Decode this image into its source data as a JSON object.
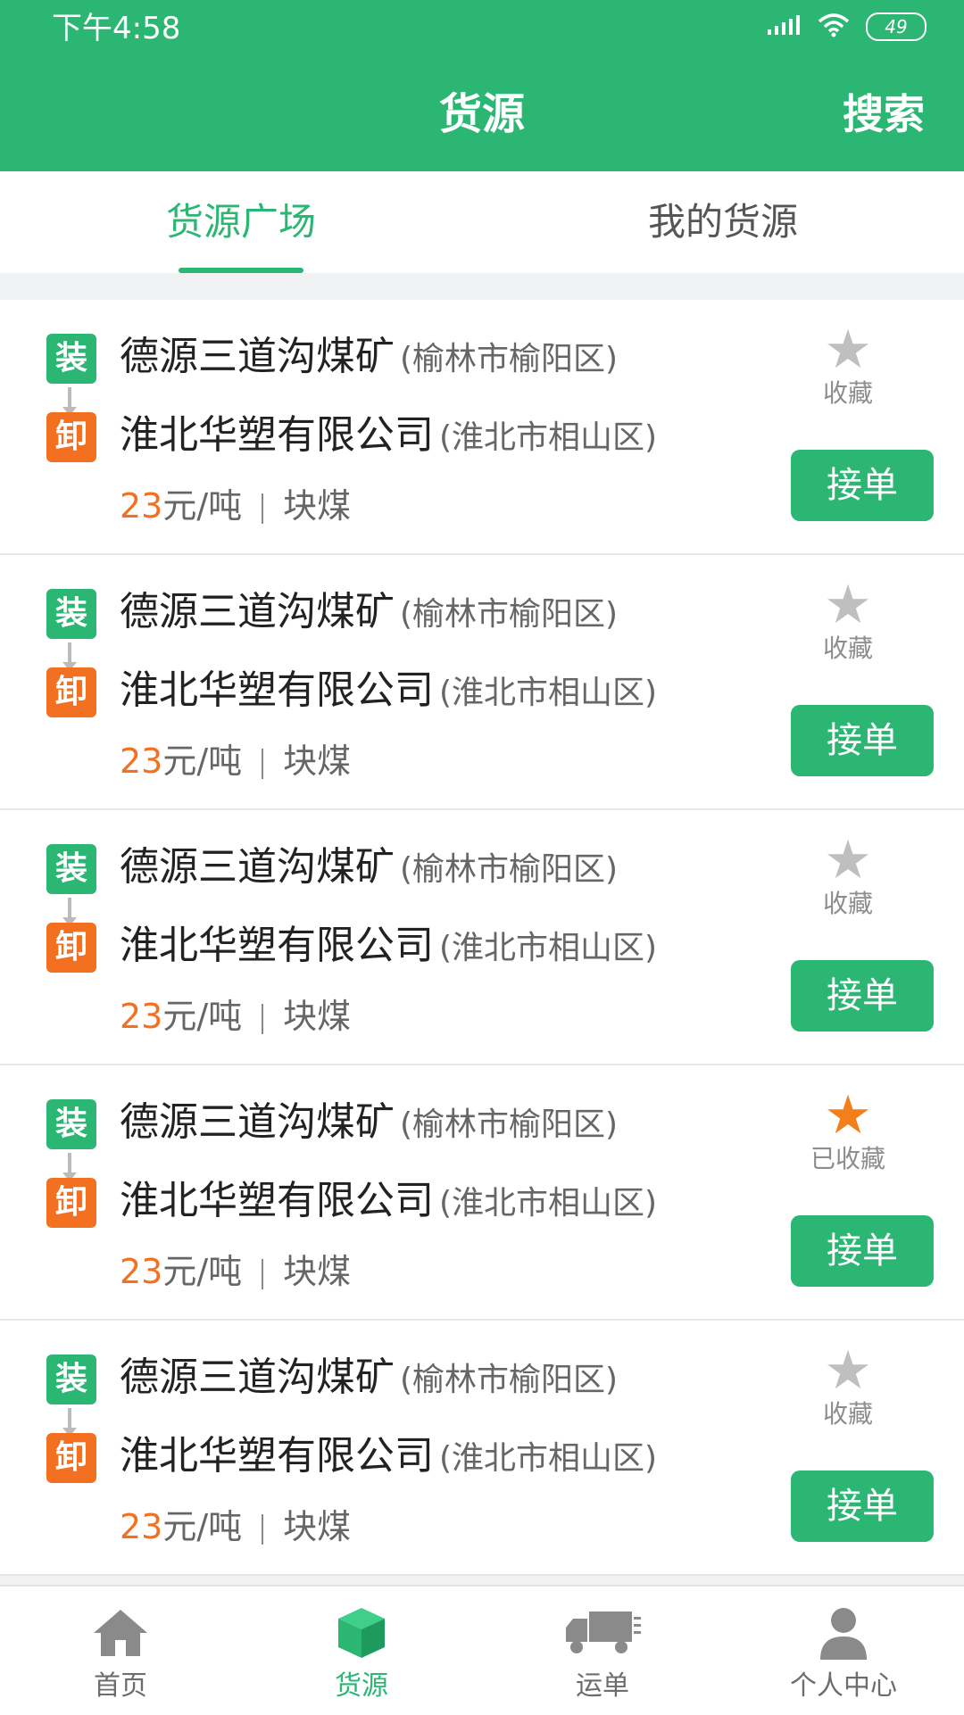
{
  "status_bar": {
    "time": "下午4:58",
    "battery": "49"
  },
  "header": {
    "title": "货源",
    "search": "搜索"
  },
  "tabs": [
    {
      "label": "货源广场",
      "active": true
    },
    {
      "label": "我的货源",
      "active": false
    }
  ],
  "cards": [
    {
      "load_badge": "装",
      "unload_badge": "卸",
      "origin": "德源三道沟煤矿",
      "origin_area": "(榆林市榆阳区)",
      "destination": "淮北华塑有限公司",
      "destination_area": "(淮北市相山区)",
      "price": "23",
      "unit": "元/吨",
      "cargo": "块煤",
      "favorite": "收藏",
      "favorited": false,
      "take_label": "接单"
    },
    {
      "load_badge": "装",
      "unload_badge": "卸",
      "origin": "德源三道沟煤矿",
      "origin_area": "(榆林市榆阳区)",
      "destination": "淮北华塑有限公司",
      "destination_area": "(淮北市相山区)",
      "price": "23",
      "unit": "元/吨",
      "cargo": "块煤",
      "favorite": "收藏",
      "favorited": false,
      "take_label": "接单"
    },
    {
      "load_badge": "装",
      "unload_badge": "卸",
      "origin": "德源三道沟煤矿",
      "origin_area": "(榆林市榆阳区)",
      "destination": "淮北华塑有限公司",
      "destination_area": "(淮北市相山区)",
      "price": "23",
      "unit": "元/吨",
      "cargo": "块煤",
      "favorite": "收藏",
      "favorited": false,
      "take_label": "接单"
    },
    {
      "load_badge": "装",
      "unload_badge": "卸",
      "origin": "德源三道沟煤矿",
      "origin_area": "(榆林市榆阳区)",
      "destination": "淮北华塑有限公司",
      "destination_area": "(淮北市相山区)",
      "price": "23",
      "unit": "元/吨",
      "cargo": "块煤",
      "favorite": "已收藏",
      "favorited": true,
      "take_label": "接单"
    },
    {
      "load_badge": "装",
      "unload_badge": "卸",
      "origin": "德源三道沟煤矿",
      "origin_area": "(榆林市榆阳区)",
      "destination": "淮北华塑有限公司",
      "destination_area": "(淮北市相山区)",
      "price": "23",
      "unit": "元/吨",
      "cargo": "块煤",
      "favorite": "收藏",
      "favorited": false,
      "take_label": "接单"
    }
  ],
  "bottom_nav": [
    {
      "label": "首页",
      "icon": "home-icon",
      "active": false
    },
    {
      "label": "货源",
      "icon": "cargo-box-icon",
      "active": true
    },
    {
      "label": "运单",
      "icon": "truck-icon",
      "active": false
    },
    {
      "label": "个人中心",
      "icon": "user-icon",
      "active": false
    }
  ],
  "colors": {
    "primary": "#2bb673",
    "orange": "#f37021",
    "star_active": "#f37f1a"
  }
}
